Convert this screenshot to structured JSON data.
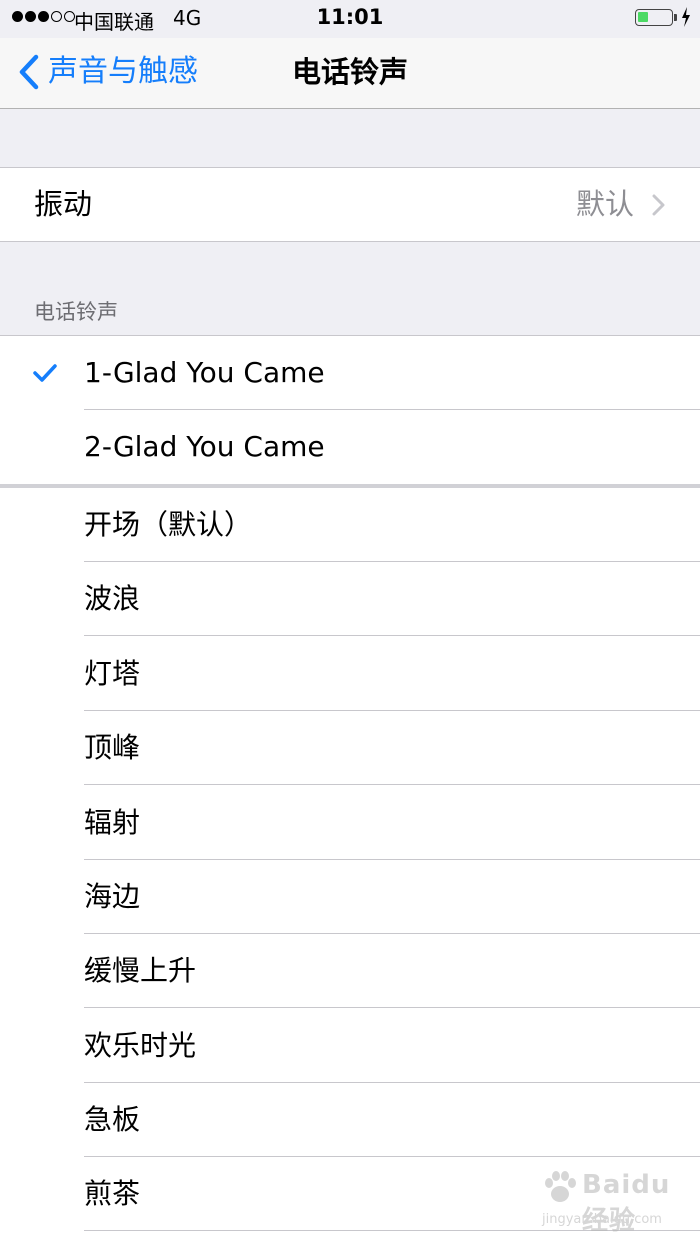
{
  "status_bar": {
    "carrier": "中国联通",
    "network": "4G",
    "time": "11:01",
    "battery_level": 0.33,
    "battery_color": "#4cd964"
  },
  "nav": {
    "back_label": "声音与触感",
    "title": "电话铃声",
    "accent_color": "#157efb"
  },
  "vibration": {
    "label": "振动",
    "value": "默认"
  },
  "section_header": "电话铃声",
  "custom_ringtones": [
    {
      "label": "1-Glad You Came",
      "selected": true
    },
    {
      "label": "2-Glad You Came",
      "selected": false
    }
  ],
  "ringtones": [
    "开场（默认）",
    "波浪",
    "灯塔",
    "顶峰",
    "辐射",
    "海边",
    "缓慢上升",
    "欢乐时光",
    "急板",
    "煎茶"
  ],
  "watermark": {
    "text": "Baidu经验",
    "sub": "jingyan.baidu.com"
  }
}
